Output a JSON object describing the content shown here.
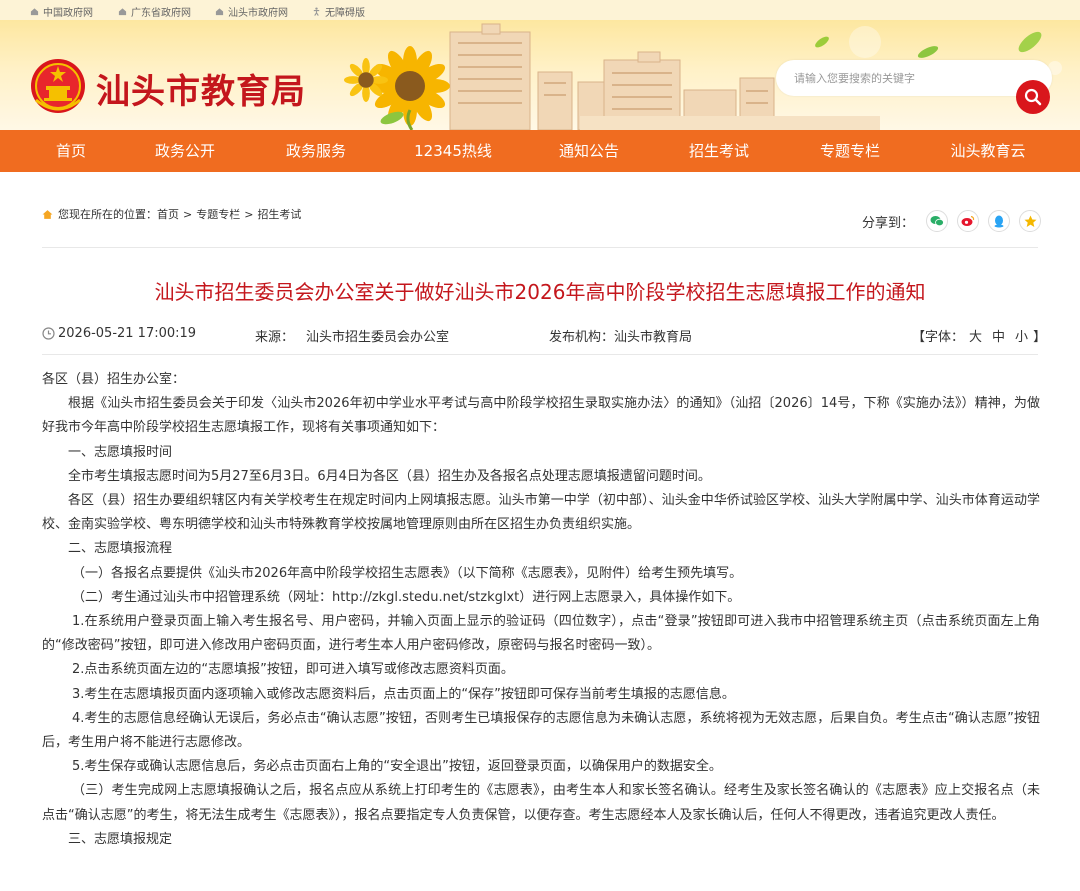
{
  "top_links": [
    "中国政府网",
    "广东省政府网",
    "汕头市政府网",
    "无障碍版"
  ],
  "site": {
    "title": "汕头市教育局"
  },
  "search": {
    "placeholder": "请输入您要搜索的关键字"
  },
  "nav": [
    "首页",
    "政务公开",
    "政务服务",
    "12345热线",
    "通知公告",
    "招生考试",
    "专题专栏",
    "汕头教育云"
  ],
  "breadcrumb": {
    "prefix": "您现在所在的位置：",
    "items": [
      "首页",
      "专题专栏",
      "招生考试"
    ],
    "sep": ">"
  },
  "share": {
    "label": "分享到：",
    "icons": [
      "wechat-icon",
      "weibo-icon",
      "qq-icon",
      "qzone-icon"
    ]
  },
  "colors": {
    "brand_red": "#c4161c",
    "nav_orange": "#f06c20",
    "wechat": "#2aae67",
    "weibo": "#e6162d",
    "qq": "#2aa4f4",
    "qzone": "#f5b800"
  },
  "article": {
    "title": "汕头市招生委员会办公室关于做好汕头市2026年高中阶段学校招生志愿填报工作的通知",
    "date": "2026-05-21 17:00:19",
    "source_label": "来源：",
    "source": "汕头市招生委员会办公室",
    "publisher_label": "发布机构：",
    "publisher": "汕头市教育局",
    "font_label_open": "【字体：",
    "font_sizes": [
      "大",
      "中",
      "小"
    ],
    "font_label_close": "】",
    "paragraphs": [
      "各区（县）招生办公室：",
      "根据《汕头市招生委员会关于印发〈汕头市2026年初中学业水平考试与高中阶段学校招生录取实施办法〉的通知》（汕招〔2026〕14号，下称《实施办法》）精神，为做好我市今年高中阶段学校招生志愿填报工作，现将有关事项通知如下：",
      "一、志愿填报时间",
      "全市考生填报志愿时间为5月27至6月3日。6月4日为各区（县）招生办及各报名点处理志愿填报遗留问题时间。",
      "各区（县）招生办要组织辖区内有关学校考生在规定时间内上网填报志愿。汕头市第一中学（初中部）、汕头金中华侨试验区学校、汕头大学附属中学、汕头市体育运动学校、金南实验学校、粤东明德学校和汕头市特殊教育学校按属地管理原则由所在区招生办负责组织实施。",
      "二、志愿填报流程",
      "（一）各报名点要提供《汕头市2026年高中阶段学校招生志愿表》（以下简称《志愿表》，见附件）给考生预先填写。",
      "（二）考生通过汕头市中招管理系统（网址：http://zkgl.stedu.net/stzkglxt）进行网上志愿录入，具体操作如下。",
      "1.在系统用户登录页面上输入考生报名号、用户密码，并输入页面上显示的验证码（四位数字），点击“登录”按钮即可进入我市中招管理系统主页（点击系统页面左上角的“修改密码”按钮，即可进入修改用户密码页面，进行考生本人用户密码修改，原密码与报名时密码一致）。",
      "2.点击系统页面左边的“志愿填报”按钮，即可进入填写或修改志愿资料页面。",
      "3.考生在志愿填报页面内逐项输入或修改志愿资料后，点击页面上的“保存”按钮即可保存当前考生填报的志愿信息。",
      "4.考生的志愿信息经确认无误后，务必点击“确认志愿”按钮，否则考生已填报保存的志愿信息为未确认志愿，系统将视为无效志愿，后果自负。考生点击“确认志愿”按钮后，考生用户将不能进行志愿修改。",
      "5.考生保存或确认志愿信息后，务必点击页面右上角的“安全退出”按钮，返回登录页面，以确保用户的数据安全。",
      "（三）考生完成网上志愿填报确认之后，报名点应从系统上打印考生的《志愿表》，由考生本人和家长签名确认。经考生及家长签名确认的《志愿表》应上交报名点（未点击“确认志愿”的考生，将无法生成考生《志愿表》），报名点要指定专人负责保管，以便存查。考生志愿经本人及家长确认后，任何人不得更改，违者追究更改人责任。",
      "三、志愿填报规定"
    ]
  }
}
